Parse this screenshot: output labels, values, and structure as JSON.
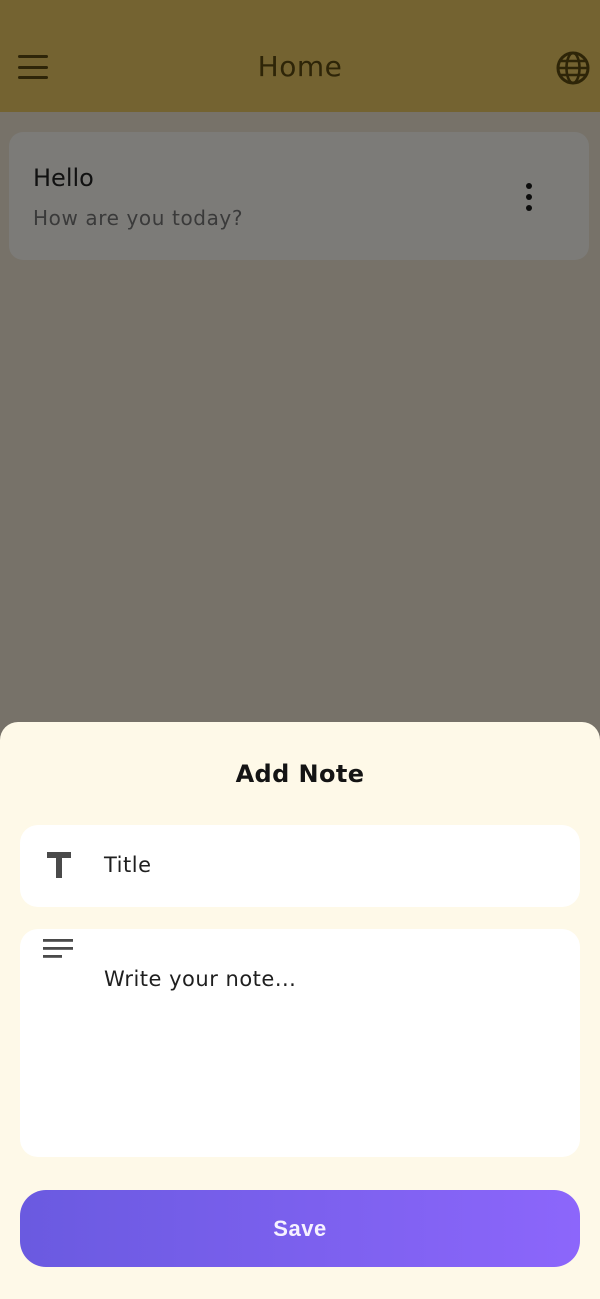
{
  "app_bar": {
    "title": "Home",
    "menu_icon": "hamburger-menu-icon",
    "language_icon": "globe-icon"
  },
  "notes": [
    {
      "title": "Hello",
      "body": "How are you today?",
      "more_icon": "more-vertical-icon"
    }
  ],
  "sheet": {
    "title": "Add Note",
    "title_field": {
      "placeholder": "Title",
      "icon": "text-title-icon"
    },
    "body_field": {
      "placeholder": "Write your note...",
      "icon": "text-lines-icon"
    },
    "save_label": "Save"
  },
  "colors": {
    "app_bar_dimmed": "#746331",
    "sheet_background": "#fef9e8",
    "save_gradient_start": "#6a5ae0",
    "save_gradient_end": "#8c66fb"
  }
}
